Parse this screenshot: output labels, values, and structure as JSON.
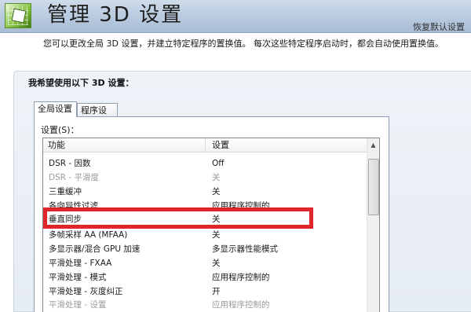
{
  "header": {
    "title": "管理 3D 设置",
    "restore_link": "恢复默认设置"
  },
  "description": "您可以更改全局 3D 设置，并建立特定程序的置换值。 每次这些特定程序启动时，都会自动使用置换值。",
  "section_title": "我希望使用以下 3D 设置：",
  "tabs": [
    {
      "label": "全局设置"
    },
    {
      "label": "程序设置"
    }
  ],
  "settings_label": "设置(S)：",
  "table": {
    "columns": [
      "功能",
      "设置"
    ],
    "rows": [
      {
        "feature": "DSR - 因数",
        "setting": "Off"
      },
      {
        "feature": "DSR - 平滑度",
        "setting": "关"
      },
      {
        "feature": "三重缓冲",
        "setting": "关"
      },
      {
        "feature": "各向异性过滤",
        "setting": "应用程序控制的"
      },
      {
        "feature": "垂直同步",
        "setting": "关"
      },
      {
        "feature": "多帧采样 AA (MFAA)",
        "setting": "关"
      },
      {
        "feature": "多显示器/混合 GPU 加速",
        "setting": "多显示器性能模式"
      },
      {
        "feature": "平滑处理 - FXAA",
        "setting": "关"
      },
      {
        "feature": "平滑处理 - 模式",
        "setting": "应用程序控制的"
      },
      {
        "feature": "平滑处理 - 灰度纠正",
        "setting": "开"
      },
      {
        "feature": "平滑处理 - 设置",
        "setting": "应用程序控制的"
      }
    ]
  },
  "colors": {
    "header_bg": "#b6c8dd",
    "highlight_border": "#e0252b",
    "disabled_text": "#9a9a9a"
  }
}
